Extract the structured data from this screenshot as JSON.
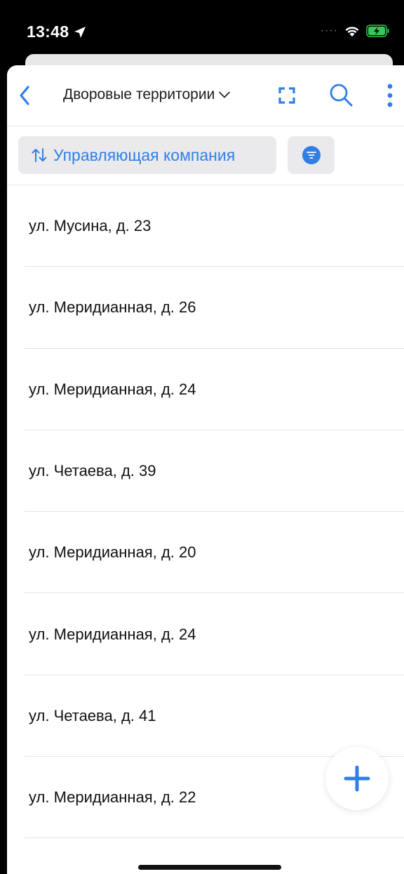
{
  "status_bar": {
    "time": "13:48"
  },
  "header": {
    "title": "Дворовые территории"
  },
  "toolbar": {
    "sort_label": "Управляющая компания"
  },
  "list": {
    "items": [
      "ул. Мусина, д. 23",
      "ул. Меридианная, д. 26",
      "ул. Меридианная, д. 24",
      "ул. Четаева, д. 39",
      "ул. Меридианная, д. 20",
      "ул. Меридианная, д. 24",
      "ул. Четаева, д. 41",
      "ул. Меридианная, д. 22"
    ]
  },
  "colors": {
    "accent": "#2f7fe6",
    "chip_bg": "#eaeaec",
    "battery": "#34c759"
  },
  "icons": [
    "location-arrow-icon",
    "cellular-dots-icon",
    "wifi-icon",
    "battery-charging-icon",
    "back-chevron-icon",
    "chevron-down-icon",
    "expand-icon",
    "search-icon",
    "more-vertical-icon",
    "sort-arrows-icon",
    "filter-icon",
    "plus-icon"
  ]
}
